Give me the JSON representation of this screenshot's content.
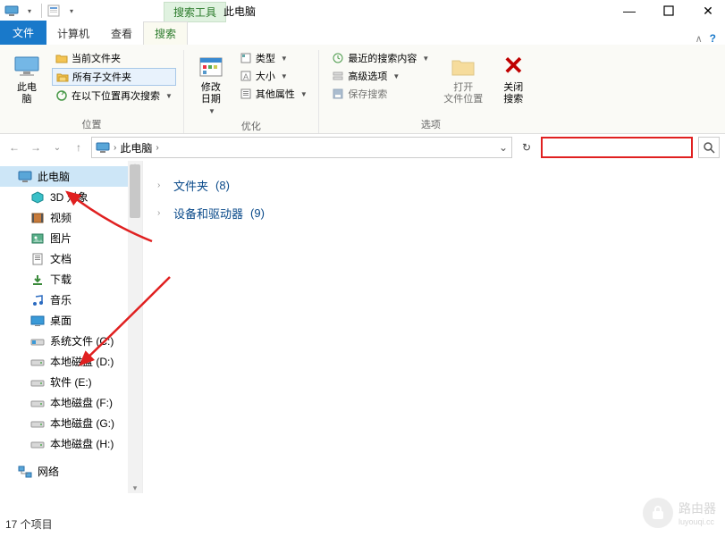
{
  "titlebar": {
    "tool_label": "搜索工具",
    "title": "此电脑"
  },
  "tabs": {
    "file": "文件",
    "computer": "计算机",
    "view": "查看",
    "search": "搜索"
  },
  "ribbon": {
    "group_location": {
      "label": "位置",
      "this_pc": "此电\n脑",
      "current_folder": "当前文件夹",
      "all_subfolders": "所有子文件夹",
      "search_again_in": "在以下位置再次搜索"
    },
    "group_optimize": {
      "label": "优化",
      "modify_date": "修改\n日期",
      "type": "类型",
      "size": "大小",
      "other_props": "其他属性"
    },
    "group_options": {
      "label": "选项",
      "recent": "最近的搜索内容",
      "advanced": "高级选项",
      "save_search": "保存搜索",
      "open_location": "打开\n文件位置",
      "close_search": "关闭\n搜索"
    }
  },
  "address": {
    "root": "此电脑"
  },
  "tree": {
    "items": [
      {
        "label": "此电脑",
        "icon": "pc",
        "selected": true,
        "child": false
      },
      {
        "label": "3D 对象",
        "icon": "cube",
        "child": true
      },
      {
        "label": "视频",
        "icon": "video",
        "child": true
      },
      {
        "label": "图片",
        "icon": "image",
        "child": true
      },
      {
        "label": "文档",
        "icon": "doc",
        "child": true
      },
      {
        "label": "下载",
        "icon": "download",
        "child": true
      },
      {
        "label": "音乐",
        "icon": "music",
        "child": true
      },
      {
        "label": "桌面",
        "icon": "desktop",
        "child": true
      },
      {
        "label": "系统文件 (C:)",
        "icon": "drive_win",
        "child": true
      },
      {
        "label": "本地磁盘 (D:)",
        "icon": "drive",
        "child": true
      },
      {
        "label": "软件 (E:)",
        "icon": "drive",
        "child": true
      },
      {
        "label": "本地磁盘 (F:)",
        "icon": "drive",
        "child": true
      },
      {
        "label": "本地磁盘 (G:)",
        "icon": "drive",
        "child": true
      },
      {
        "label": "本地磁盘 (H:)",
        "icon": "drive",
        "child": true
      },
      {
        "label": "网络",
        "icon": "network",
        "child": false,
        "gap": true
      }
    ]
  },
  "main": {
    "folders_label": "文件夹",
    "folders_count": "(8)",
    "devices_label": "设备和驱动器",
    "devices_count": "(9)"
  },
  "status": {
    "items": "17 个项目"
  },
  "watermark": {
    "text": "路由器",
    "sub": "luyouqi.cc"
  },
  "search": {
    "placeholder": ""
  }
}
